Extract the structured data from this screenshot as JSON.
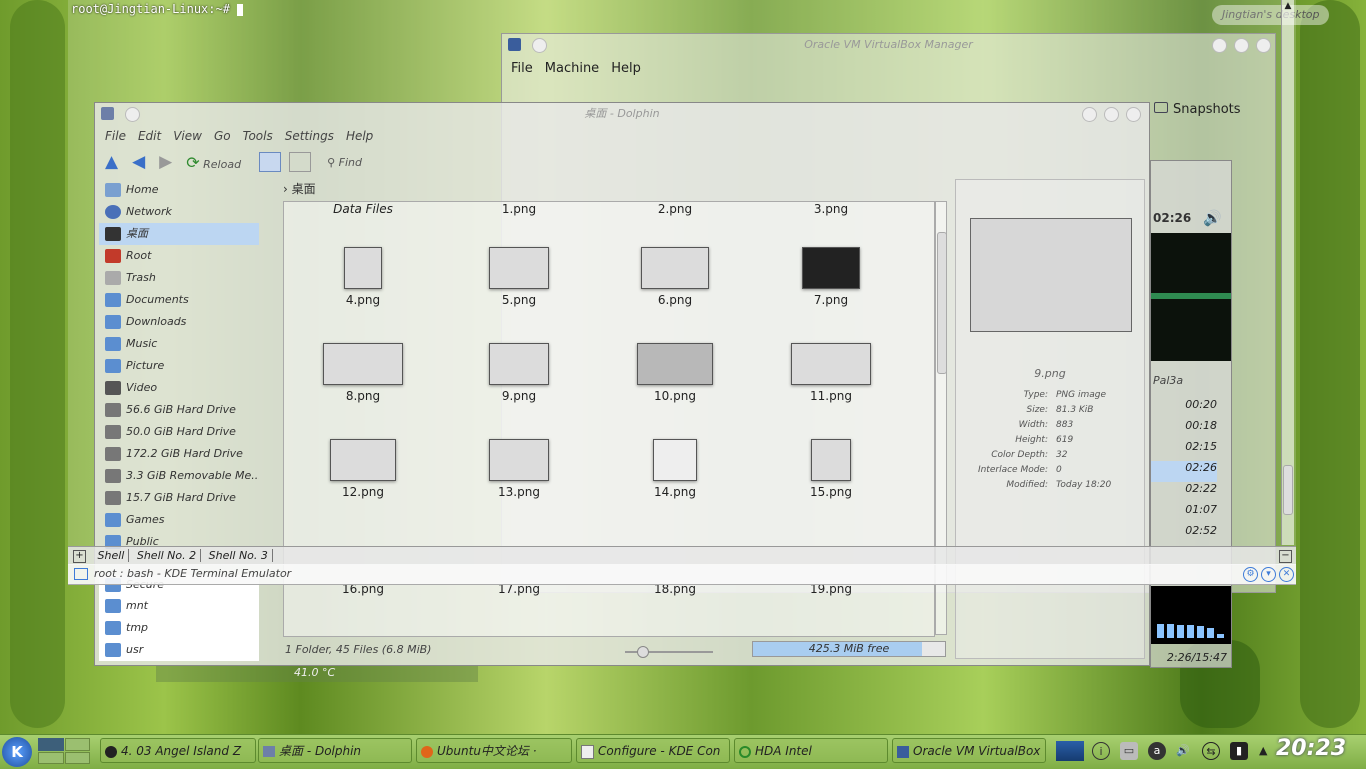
{
  "terminal": {
    "prompt": "root@Jingtian-Linux:~#",
    "tabs": [
      "Shell",
      "Shell No. 2",
      "Shell No. 3"
    ],
    "window_title": "root : bash - KDE Terminal Emulator"
  },
  "desktop_label": "Jingtian's desktop",
  "virtualbox": {
    "title": "Oracle VM VirtualBox Manager",
    "menu": [
      "File",
      "Machine",
      "Help"
    ],
    "snapshots_label": "Snapshots"
  },
  "media_player": {
    "time": "02:26",
    "playlist_header": "Pal3a",
    "durations": [
      "00:20",
      "00:18",
      "02:15",
      "02:26",
      "02:22",
      "01:07",
      "02:52"
    ],
    "position": "2:26/15:47"
  },
  "dolphin": {
    "title": "桌面 - Dolphin",
    "menu": [
      "File",
      "Edit",
      "View",
      "Go",
      "Tools",
      "Settings",
      "Help"
    ],
    "toolbar": {
      "reload": "Reload",
      "find": "Find"
    },
    "breadcrumb": "桌面",
    "places": [
      "Home",
      "Network",
      "桌面",
      "Root",
      "Trash",
      "Documents",
      "Downloads",
      "Music",
      "Picture",
      "Video",
      "56.6 GiB Hard Drive",
      "50.0 GiB Hard Drive",
      "172.2 GiB Hard Drive",
      "3.3 GiB Removable Me...",
      "15.7 GiB Hard Drive",
      "Games",
      "Public"
    ],
    "places_bottom": [
      "Secure",
      "mnt",
      "tmp",
      "usr"
    ],
    "files_row1": [
      "Data Files",
      "1.png",
      "2.png",
      "3.png"
    ],
    "files": [
      "4.png",
      "5.png",
      "6.png",
      "7.png",
      "8.png",
      "9.png",
      "10.png",
      "11.png",
      "12.png",
      "13.png",
      "14.png",
      "15.png"
    ],
    "files_last": [
      "16.png",
      "17.png",
      "18.png",
      "19.png"
    ],
    "status": "1 Folder, 45 Files (6.8 MiB)",
    "free": "425.3 MiB free",
    "info": {
      "filename": "9.png",
      "labels": [
        "Type:",
        "Size:",
        "Width:",
        "Height:",
        "Color Depth:",
        "Interlace Mode:",
        "Modified:"
      ],
      "values": [
        "PNG image",
        "81.3 KiB",
        "883",
        "619",
        "32",
        "0",
        "Today 18:20"
      ]
    }
  },
  "temperature": "41.0 °C",
  "taskbar": {
    "tasks": [
      "4. 03 Angel Island Z",
      "桌面 - Dolphin",
      "Ubuntu中文论坛 ·",
      "Configure - KDE Con",
      "HDA Intel",
      "Oracle VM VirtualBox"
    ],
    "clock": "20:23"
  },
  "colors": {
    "accent": "#3d7bd8",
    "selection": "#bcd6f2",
    "panel": "#8fbd55"
  }
}
